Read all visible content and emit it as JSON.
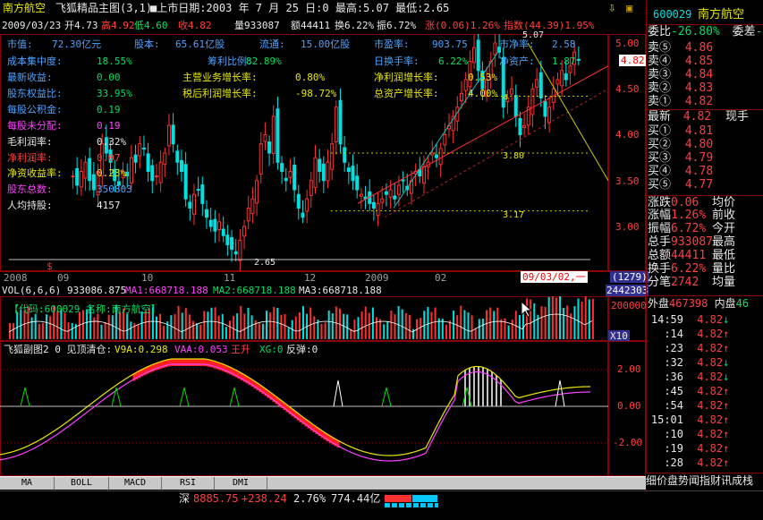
{
  "header": {
    "stock_name": "南方航空",
    "chart_title": "飞狐精品主图(3,1)",
    "date_label": "■上市日期:2003 年 7 月 25 日:0 最高:5.07 最低:2.65",
    "down_arrow_icon": "⇩",
    "lock_icon": "🔒"
  },
  "ohlc_bar": {
    "date": "2009/03/23",
    "open": "开4.73",
    "high": "高4.92",
    "low": "低4.60",
    "close": "收4.82",
    "volume": "量933087",
    "amount": "额44411",
    "turnover": "换6.22%",
    "amplitude": "振6.72%",
    "change": "涨(0.06)1.26%",
    "index": "指数(44.39)1.95%"
  },
  "fundamentals": {
    "row1": [
      {
        "label": "市值:",
        "value": "72.30亿元"
      },
      {
        "label": "股本:",
        "value": "65.61亿股"
      },
      {
        "label": "流通:",
        "value": "15.00亿股"
      },
      {
        "label": "市盈率:",
        "value": "903.75"
      },
      {
        "label": "市净率:",
        "value": "2.58"
      }
    ],
    "rows": [
      {
        "label": "成本集中度:",
        "value": "18.55%"
      },
      {
        "label": "最新收益:",
        "value": "0.00"
      },
      {
        "label": "股东权益比:",
        "value": "33.95%"
      },
      {
        "label": "每股公积金:",
        "value": "0.19"
      },
      {
        "label": "每股未分配:",
        "value": "0.19"
      },
      {
        "label": "毛利润率:",
        "value": "0.32%"
      },
      {
        "label": "净利润率:",
        "value": "0.07"
      },
      {
        "label": "净资收益率:",
        "value": "0.23%"
      },
      {
        "label": "股东总数:",
        "value": "350803"
      },
      {
        "label": "人均持股:",
        "value": "4157"
      }
    ],
    "col2": [
      {
        "label": "筹利比例:",
        "value": "82.89%"
      },
      {
        "label": "主营业务增长率:",
        "value": "0.80%"
      },
      {
        "label": "税后利润增长率:",
        "value": "-98.72%"
      }
    ],
    "col3": [
      {
        "label": "日换手率:",
        "value": "6.22%"
      },
      {
        "label": "净利润增长率:",
        "value": "0.53%"
      },
      {
        "label": "总资产增长率:",
        "value": "4.00%"
      },
      {
        "label": "净资产:",
        "value": "1.87"
      }
    ]
  },
  "price_axis": {
    "ticks": [
      "5.00",
      "4.50",
      "4.00",
      "3.50",
      "3.00"
    ],
    "current_tag": "4.82"
  },
  "chart_annotations": {
    "high_label": "5.07",
    "low_label": "2.65",
    "level_380": "3.80",
    "level_317": "3.17",
    "level_4": "4"
  },
  "time_axis": {
    "labels": [
      "2008",
      "09",
      "10",
      "11",
      "12",
      "2009",
      "02"
    ],
    "cursor_date": "09/03/02,一",
    "count": "(1279)",
    "cursor_volume": "2442303"
  },
  "volume_panel": {
    "title_vol": "VOL(6,6,6)",
    "vol_value": "933086.875",
    "ma1": "MA1:668718.188",
    "ma2": "MA2:668718.188",
    "ma3": "MA3:668718.188",
    "code_label": "【代码:600029 名称:南方航空】",
    "axis_top": "200000",
    "axis_unit": "X10"
  },
  "indicator_panel": {
    "title": "飞狐副图2 0 见顶清仓:",
    "v9a": "V9A:0.298",
    "vaa": "VAA:0.053",
    "wangsheng": "王升",
    "xg": "XG:0",
    "fantan": "反弹:0",
    "axis_ticks": [
      "2.00",
      "0.00",
      "-2.00"
    ]
  },
  "tabs": [
    "MA",
    "BOLL",
    "MACD",
    "RSI",
    "DMI"
  ],
  "quote_panel": {
    "code": "600029",
    "name": "南方航空",
    "ratio_label": "委比",
    "ratio_value": "-26.80%",
    "diff_label": "委差",
    "diff_value": "-",
    "asks": [
      {
        "label": "卖⑤",
        "price": "4.86"
      },
      {
        "label": "卖④",
        "price": "4.85"
      },
      {
        "label": "卖③",
        "price": "4.84"
      },
      {
        "label": "卖②",
        "price": "4.83"
      },
      {
        "label": "卖①",
        "price": "4.82"
      }
    ],
    "last_label": "最新",
    "last_price": "4.82",
    "last_hand": "现手",
    "bids": [
      {
        "label": "买①",
        "price": "4.81"
      },
      {
        "label": "买②",
        "price": "4.80"
      },
      {
        "label": "买③",
        "price": "4.79"
      },
      {
        "label": "买④",
        "price": "4.78"
      },
      {
        "label": "买⑤",
        "price": "4.77"
      }
    ],
    "stats": [
      {
        "l1": "涨跌",
        "v1": "0.06",
        "l2": "均价"
      },
      {
        "l1": "涨幅",
        "v1": "1.26%",
        "l2": "前收"
      },
      {
        "l1": "振幅",
        "v1": "6.72%",
        "l2": "今开"
      },
      {
        "l1": "总手",
        "v1": "933087",
        "l2": "最高"
      },
      {
        "l1": "总额",
        "v1": "44411",
        "l2": "最低"
      },
      {
        "l1": "换手",
        "v1": "6.22%",
        "l2": "量比"
      },
      {
        "l1": "分笔",
        "v1": "2742",
        "l2": "均量"
      }
    ],
    "outer_label": "外盘",
    "outer_value": "467398",
    "inner_label": "内盘",
    "inner_value": "46"
  },
  "ticks": [
    {
      "time": "14:59",
      "price": "4.82",
      "arrow": "↓"
    },
    {
      "time": ":14",
      "price": "4.82",
      "arrow": "↑"
    },
    {
      "time": ":23",
      "price": "4.82",
      "arrow": "↑"
    },
    {
      "time": ":32",
      "price": "4.82",
      "arrow": "↓"
    },
    {
      "time": ":36",
      "price": "4.82",
      "arrow": "↓"
    },
    {
      "time": ":45",
      "price": "4.82",
      "arrow": "↑"
    },
    {
      "time": ":54",
      "price": "4.82",
      "arrow": "↑"
    },
    {
      "time": "15:01",
      "price": "4.82",
      "arrow": "↑"
    },
    {
      "time": ":10",
      "price": "4.82",
      "arrow": "↑"
    },
    {
      "time": ":19",
      "price": "4.82",
      "arrow": "↑"
    },
    {
      "time": ":28",
      "price": "4.82",
      "arrow": "↑"
    }
  ],
  "right_tabs": "细价盘势闻指财讯成栈",
  "status": {
    "index_name": "深",
    "index_value": "8885.75",
    "index_change": "+238.24",
    "index_pct": "2.76%",
    "index_amount": "774.44亿"
  },
  "colors": {
    "up": "#ff3030",
    "down": "#00e0e0",
    "background": "#000000",
    "frame": "#8b0000"
  }
}
